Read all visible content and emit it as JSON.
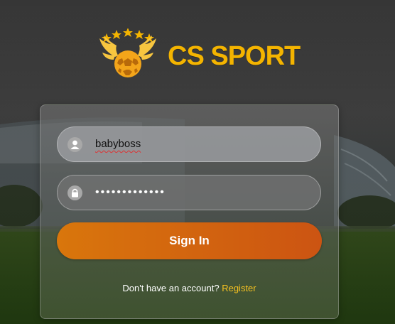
{
  "brand": {
    "name": "CS SPORT",
    "logo_icon": "winged-soccer-ball-logo",
    "accent_color": "#f4b400"
  },
  "login": {
    "username_value": "babyboss",
    "username_icon": "user-icon",
    "password_value": "•••••••••••••",
    "password_icon": "lock-icon",
    "signin_label": "Sign In",
    "signin_color": "#d9660e",
    "register_prompt": "Don't have an account?",
    "register_link": "Register",
    "link_color": "#f4c020"
  }
}
